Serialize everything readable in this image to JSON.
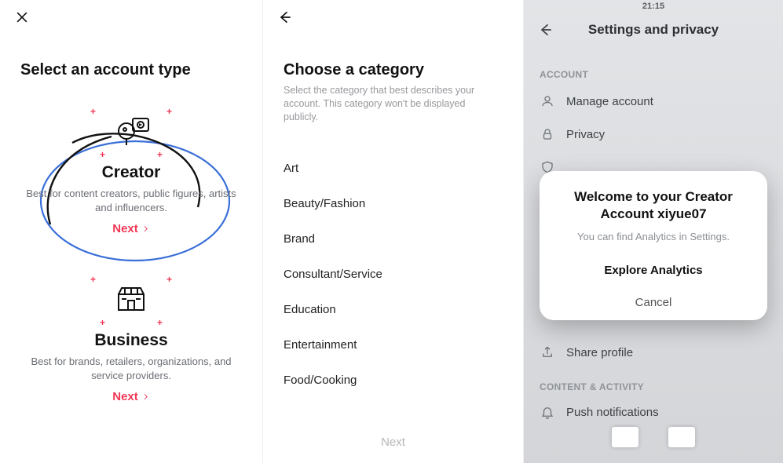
{
  "panel1": {
    "title": "Select an account type",
    "creator": {
      "name": "Creator",
      "desc": "Best for content creators, public figures, artists and influencers.",
      "next": "Next"
    },
    "business": {
      "name": "Business",
      "desc": "Best for brands, retailers, organizations, and service providers.",
      "next": "Next"
    }
  },
  "panel2": {
    "title": "Choose a category",
    "subtitle": "Select the category that best describes your account. This category won't be displayed publicly.",
    "categories": [
      "Art",
      "Beauty/Fashion",
      "Brand",
      "Consultant/Service",
      "Education",
      "Entertainment",
      "Food/Cooking"
    ],
    "next": "Next"
  },
  "panel3": {
    "status": {
      "time": "21:15"
    },
    "title": "Settings and privacy",
    "section_account": "ACCOUNT",
    "items_account": [
      "Manage account",
      "Privacy"
    ],
    "item_share": "Share profile",
    "section_content": "CONTENT & ACTIVITY",
    "item_push": "Push notifications",
    "modal": {
      "title_line1": "Welcome to your Creator",
      "title_line2": "Account xiyue07",
      "subtitle": "You can find Analytics in Settings.",
      "primary": "Explore Analytics",
      "secondary": "Cancel"
    }
  }
}
